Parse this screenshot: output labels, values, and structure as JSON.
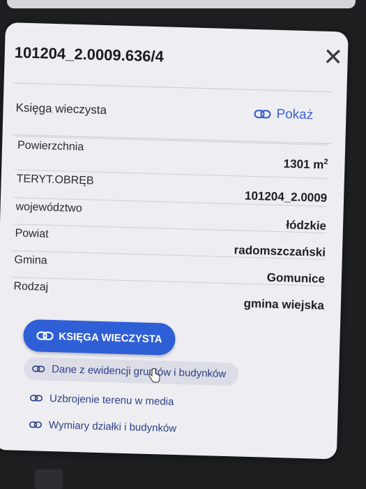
{
  "header": {
    "title": "101204_2.0009.636/4"
  },
  "kw": {
    "label": "Księga wieczysta",
    "link_label": "Pokaż"
  },
  "rows": [
    {
      "label": "Powierzchnia",
      "value": "1301 m",
      "sup": "2"
    },
    {
      "label": "TERYT.OBRĘB",
      "value": "101204_2.0009"
    },
    {
      "label": "województwo",
      "value": "łódzkie"
    },
    {
      "label": "Powiat",
      "value": "radomszczański"
    },
    {
      "label": "Gmina",
      "value": "Gomunice"
    },
    {
      "label": "Rodzaj",
      "value": "gmina wiejska"
    }
  ],
  "actions": {
    "primary": "KSIĘGA WIECZYSTA",
    "links": [
      "Dane z ewidencji gruntów i budynków",
      "Uzbrojenie terenu w media",
      "Wymiary działki i budynków"
    ]
  },
  "colors": {
    "accent": "#2f5fd6",
    "link": "#3a5fd0",
    "panel": "#eeeef2"
  }
}
